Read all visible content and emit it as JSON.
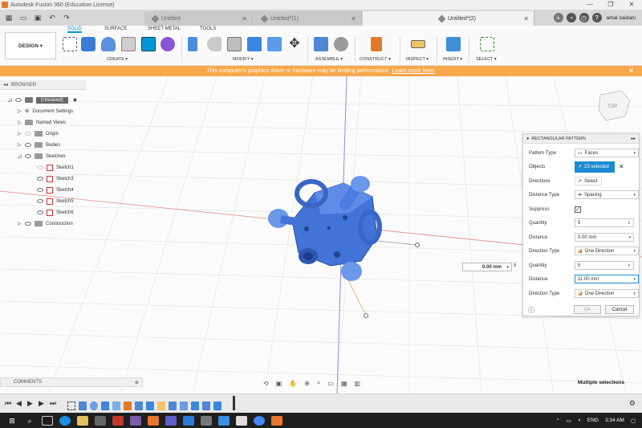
{
  "window": {
    "title": "Autodesk Fusion 360 (Education License)",
    "controls": [
      "—",
      "❐",
      "✕"
    ]
  },
  "tabs": {
    "items": [
      {
        "label": "Untitled",
        "active": false
      },
      {
        "label": "Untitled*(1)",
        "active": false
      },
      {
        "label": "Untitled*(2)",
        "active": true
      }
    ],
    "user": "amal saidani"
  },
  "toolbar": {
    "workspace": "DESIGN ▾",
    "subtabs": [
      "SOLID",
      "SURFACE",
      "SHEET METAL",
      "TOOLS"
    ],
    "groups": [
      "CREATE ▾",
      "MODIFY ▾",
      "ASSEMBLE ▾",
      "CONSTRUCT ▾",
      "INSPECT ▾",
      "INSERT ▾",
      "SELECT ▾"
    ]
  },
  "warning": {
    "text": "This computer's graphics driver or hardware may be limiting performance.",
    "link": "Learn more here."
  },
  "browser": {
    "header": "BROWSER",
    "root": "(Unsaved)",
    "items": [
      {
        "label": "Document Settings",
        "level": 1
      },
      {
        "label": "Named Views",
        "level": 1
      },
      {
        "label": "Origin",
        "level": 1
      },
      {
        "label": "Bodies",
        "level": 1
      },
      {
        "label": "Sketches",
        "level": 1
      },
      {
        "label": "Sketch1",
        "level": 2
      },
      {
        "label": "Sketch3",
        "level": 2
      },
      {
        "label": "Sketch4",
        "level": 2
      },
      {
        "label": "Sketch5",
        "level": 2
      },
      {
        "label": "Sketch6",
        "level": 2
      },
      {
        "label": "Construction",
        "level": 1
      }
    ]
  },
  "viewcube": {
    "label": "TOP"
  },
  "dialog": {
    "title": "RECTANGULAR PATTERN",
    "rows": {
      "pattern_type_label": "Pattern Type",
      "pattern_type_value": "Faces",
      "objects_label": "Objects",
      "objects_value": "23 selected",
      "directions_label": "Directions",
      "directions_value": "Select",
      "distance_type_label": "Distance Type",
      "distance_type_value": "Spacing",
      "suppress_label": "Suppress",
      "suppress_value": "✓",
      "quantity1_label": "Quantity",
      "quantity1_value": "5",
      "distance1_label": "Distance",
      "distance1_value": "0.00 mm",
      "direction_type1_label": "Direction Type",
      "direction_type1_value": "One Direction",
      "quantity2_label": "Quantity",
      "quantity2_value": "5",
      "distance2_label": "Distance",
      "distance2_value": "11.00 mm",
      "direction_type2_label": "Direction Type",
      "direction_type2_value": "One Direction"
    },
    "ok": "OK",
    "cancel": "Cancel"
  },
  "floating_input": {
    "value": "0.00 mm",
    "quantity": "5"
  },
  "comments": {
    "label": "COMMENTS"
  },
  "status": {
    "selection": "Multiple selections"
  },
  "taskbar": {
    "lang": "ENG",
    "time": "3:34 AM"
  },
  "colors": {
    "accent": "#0696d7",
    "warning": "#f8a84a",
    "model": "#3f6fd8"
  }
}
